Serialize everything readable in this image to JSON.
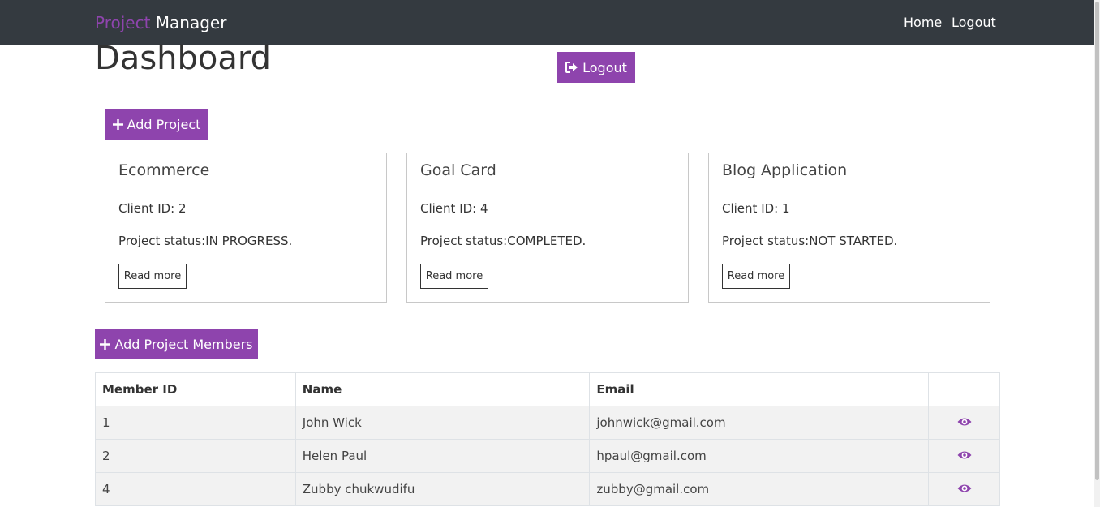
{
  "navbar": {
    "brand_part1": "Project",
    "brand_part2": "Manager",
    "links": [
      {
        "label": "Home"
      },
      {
        "label": "Logout"
      }
    ]
  },
  "page": {
    "title": "Dashboard",
    "logout_button": {
      "label": "Logout",
      "icon": "sign-out-icon"
    }
  },
  "add_project_button": {
    "label": "Add Project",
    "icon": "plus-icon"
  },
  "projects": [
    {
      "name": "Ecommerce",
      "client": "Client ID: 2",
      "status": "Project status:IN PROGRESS.",
      "read_more": "Read more"
    },
    {
      "name": "Goal Card",
      "client": "Client ID: 4",
      "status": "Project status:COMPLETED.",
      "read_more": "Read more"
    },
    {
      "name": "Blog Application",
      "client": "Client ID: 1",
      "status": "Project status:NOT STARTED.",
      "read_more": "Read more"
    }
  ],
  "add_members_button": {
    "label": "Add Project Members",
    "icon": "plus-icon"
  },
  "members_table": {
    "headers": [
      "Member ID",
      "Name",
      "Email",
      ""
    ],
    "rows": [
      {
        "id": "1",
        "name": "John Wick",
        "email": "johnwick@gmail.com",
        "action_icon": "eye-icon"
      },
      {
        "id": "2",
        "name": "Helen Paul",
        "email": "hpaul@gmail.com",
        "action_icon": "eye-icon"
      },
      {
        "id": "4",
        "name": "Zubby chukwudifu",
        "email": "zubby@gmail.com",
        "action_icon": "eye-icon"
      }
    ]
  },
  "colors": {
    "navbar_bg": "#343a40",
    "accent": "#8e44ad",
    "brand_accent": "#8e44ad",
    "row_stripe": "#f2f2f2"
  }
}
